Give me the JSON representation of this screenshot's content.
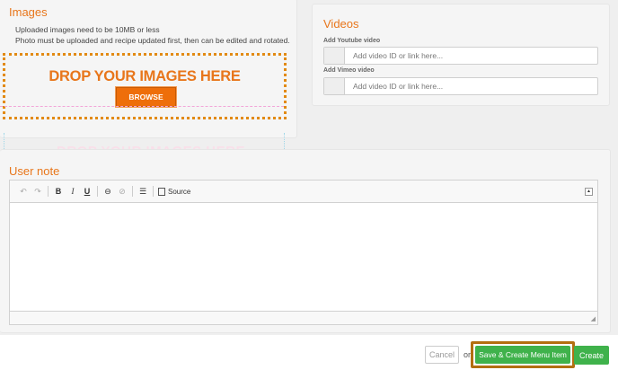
{
  "images": {
    "title": "Images",
    "hint1": "Uploaded images need to be 10MB or less",
    "hint2": "Photo must be uploaded and recipe updated first, then can be edited and rotated.",
    "drop_text": "DROP YOUR IMAGES HERE",
    "browse_label": "BROWSE",
    "ghost_text": "DROP YOUR IMAGES HERE"
  },
  "videos": {
    "title": "Videos",
    "youtube_label": "Add Youtube video",
    "youtube_placeholder": "Add video ID or link here...",
    "vimeo_label": "Add Vimeo video",
    "vimeo_placeholder": "Add video ID or link here..."
  },
  "note": {
    "title": "User note",
    "source_label": "Source",
    "toolbar": {
      "undo": "↶",
      "redo": "↷",
      "bold": "B",
      "italic": "I",
      "underline": "U",
      "link": "⊖",
      "unlink": "⊘",
      "list": "☰",
      "collapse": "▲",
      "resize": "◢"
    }
  },
  "footer": {
    "cancel_label": "Cancel",
    "or_text": "or",
    "save_label": "Save & Create Menu Item",
    "create_label": "Create"
  },
  "colors": {
    "accent_orange": "#e8761b",
    "primary_green": "#3fb24b",
    "highlight_border": "#b36f10"
  }
}
